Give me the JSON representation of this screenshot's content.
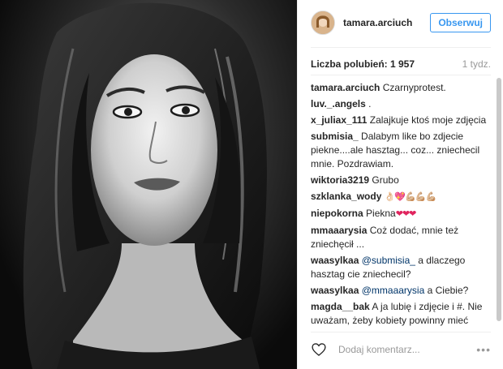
{
  "post": {
    "owner": "tamara.arciuch",
    "follow_label": "Obserwuj",
    "likes_text": "Liczba polubień: 1 957",
    "time_ago": "1 tydz."
  },
  "comments": [
    {
      "user": "tamara.arciuch",
      "text": "Czarnyprotest."
    },
    {
      "user": "luv._.angels",
      "text": "."
    },
    {
      "user": "x_juliax_111",
      "text": "Zalajkuje ktoś moje zdjęcia"
    },
    {
      "user": "submisia_",
      "text": "Dalabym like bo zdjecie piekne....ale hasztag... coz... zniechecil mnie. Pozdrawiam."
    },
    {
      "user": "wiktoria3219",
      "text": "Grubo"
    },
    {
      "user": "szklanka_wody",
      "emoji": "👌🏻💖💪🏼💪🏼💪🏼"
    },
    {
      "user": "niepokorna",
      "text": "Piekna",
      "emoji": "❤❤❤"
    },
    {
      "user": "mmaaarysia",
      "text": "Coż dodać, mnie też zniechęcił ..."
    },
    {
      "user": "waasylkaa",
      "mention": "@submisia_",
      "text": "a dlaczego hasztag cie zniechecil?"
    },
    {
      "user": "waasylkaa",
      "mention": "@mmaaarysia",
      "text": "a Ciebie?"
    },
    {
      "user": "magda__bak",
      "text": "A ja lubię i zdjęcie i #. Nie uważam, żeby kobiety powinny mieć prawo usuwać ciążę kiedy chcą i jak chcą, ale nawet sobie nie wyobrażam"
    }
  ],
  "footer": {
    "add_comment_placeholder": "Dodaj komentarz...",
    "more_label": "•••"
  },
  "icons": {
    "like": "heart-icon",
    "more": "more-options-icon"
  }
}
